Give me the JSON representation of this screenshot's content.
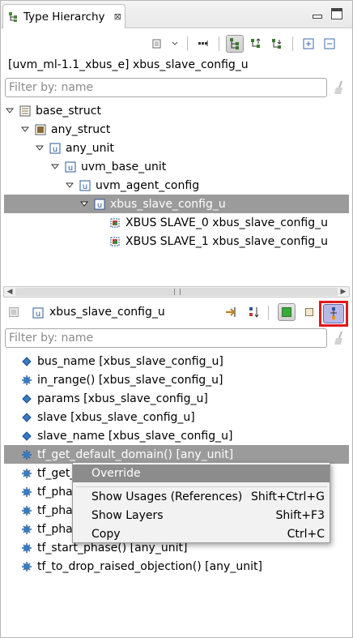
{
  "view": {
    "tab_title": "Type Hierarchy",
    "tab_close_glyph": "⊠",
    "breadcrumb": "[uvm_ml-1.1_xbus_e] xbus_slave_config_u",
    "filter_placeholder": "Filter by: name"
  },
  "hierarchy": [
    {
      "label": "base_struct",
      "icon": "struct-icon"
    },
    {
      "label": "any_struct",
      "icon": "struct-icon"
    },
    {
      "label": "any_unit",
      "icon": "unit-icon"
    },
    {
      "label": "uvm_base_unit",
      "icon": "unit-icon"
    },
    {
      "label": "uvm_agent_config",
      "icon": "unit-icon"
    },
    {
      "label": "xbus_slave_config_u",
      "icon": "unit-icon"
    },
    {
      "label": "XBUS SLAVE_0 xbus_slave_config_u",
      "icon": "instance-icon"
    },
    {
      "label": "XBUS SLAVE_1 xbus_slave_config_u",
      "icon": "instance-icon"
    }
  ],
  "members_header": {
    "title": "xbus_slave_config_u",
    "filter_placeholder": "Filter by: name"
  },
  "members": [
    {
      "label": "bus_name [xbus_slave_config_u]",
      "icon": "field-icon"
    },
    {
      "label": "in_range() [xbus_slave_config_u]",
      "icon": "method-icon"
    },
    {
      "label": "params [xbus_slave_config_u]",
      "icon": "field-icon"
    },
    {
      "label": "slave [xbus_slave_config_u]",
      "icon": "field-icon"
    },
    {
      "label": "slave_name [xbus_slave_config_u]",
      "icon": "field-icon"
    },
    {
      "label": "tf_get_default_domain() [any_unit]",
      "icon": "method-icon"
    },
    {
      "label": "tf_get_",
      "icon": "method-icon"
    },
    {
      "label": "tf_pha",
      "icon": "method-icon"
    },
    {
      "label": "tf_pha",
      "icon": "method-icon"
    },
    {
      "label": "tf_pha",
      "icon": "method-icon"
    },
    {
      "label": "tf_start_phase() [any_unit]",
      "icon": "method-icon"
    },
    {
      "label": "tf_to_drop_raised_objection() [any_unit]",
      "icon": "method-icon"
    }
  ],
  "context_menu": {
    "items": [
      {
        "label": "Override",
        "shortcut": ""
      },
      {
        "label": "Show Usages (References)",
        "shortcut": "Shift+Ctrl+G"
      },
      {
        "label": "Show Layers",
        "shortcut": "Shift+F3"
      },
      {
        "label": "Copy",
        "shortcut": "Ctrl+C"
      }
    ]
  },
  "colors": {
    "selection": "#9b9b9b",
    "highlight_box": "#e0191b",
    "struct_icon": "#7a5a2a",
    "unit_icon": "#2a5a9a",
    "field_icon": "#2a6aaa",
    "method_icon": "#2f6f9f"
  }
}
